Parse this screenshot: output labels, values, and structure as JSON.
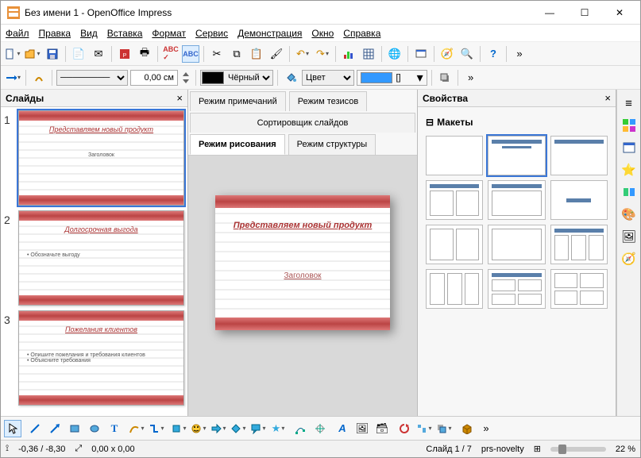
{
  "window": {
    "title": "Без имени 1 - OpenOffice Impress"
  },
  "menu": {
    "file": "Файл",
    "edit": "Правка",
    "view": "Вид",
    "insert": "Вставка",
    "format": "Формат",
    "tools": "Сервис",
    "demo": "Демонстрация",
    "window": "Окно",
    "help": "Справка"
  },
  "toolbar2": {
    "width": "0,00 см",
    "color_name": "Чёрный",
    "fill_label": "Цвет",
    "swatch_label": "[]"
  },
  "panels": {
    "slides": "Слайды",
    "properties": "Свойства",
    "layouts": "Макеты"
  },
  "tabs": {
    "notes": "Режим примечаний",
    "handout": "Режим тезисов",
    "sorter": "Сортировщик слайдов",
    "normal": "Режим рисования",
    "outline": "Режим структуры"
  },
  "slides": [
    {
      "n": "1",
      "title": "Представляем новый продукт",
      "body": "Заголовок"
    },
    {
      "n": "2",
      "title": "Долгосрочная выгода",
      "body": "• Обозначьте выгоду"
    },
    {
      "n": "3",
      "title": "Пожелания клиентов",
      "body": "• Опишите пожелания и требования клиентов\n• Объясните требования"
    }
  ],
  "main_slide": {
    "title": "Представляем новый продукт",
    "body": "Заголовок"
  },
  "status": {
    "coords": "-0,36 / -8,30",
    "size": "0,00 x 0,00",
    "slide": "Слайд 1 / 7",
    "template": "prs-novelty",
    "zoom": "22 %"
  }
}
